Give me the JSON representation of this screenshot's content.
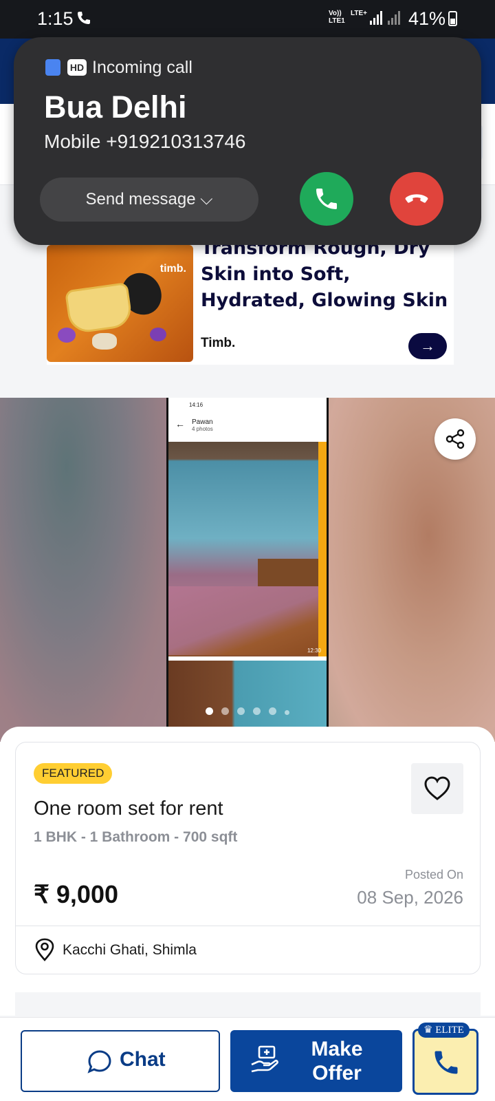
{
  "status_bar": {
    "time": "1:15",
    "network": "Vo)) LTE1",
    "lte": "LTE+",
    "battery": "41%"
  },
  "incoming_call": {
    "label": "Incoming call",
    "hd_badge": "HD",
    "caller_name": "Bua Delhi",
    "caller_number": "Mobile  +919210313746",
    "send_message_label": "Send message",
    "accept_color": "#1faa5a",
    "decline_color": "#e0443c"
  },
  "ad": {
    "image_brand": "timb.",
    "title": "Transform Rough, Dry Skin into Soft, Hydrated, Glowing Skin",
    "advertiser": "Timb.",
    "cta_icon": "arrow-right-icon"
  },
  "gallery": {
    "photo_header_title": "Pawan",
    "photo_header_sub": "4 photos",
    "photo_status_time": "14:16",
    "photo_timestamp": "12:30",
    "current_index": 1,
    "total_dots": 6
  },
  "listing": {
    "badge": "FEATURED",
    "title": "One room set for rent",
    "specs": "1 BHK - 1 Bathroom - 700 sqft",
    "price": "₹ 9,000",
    "posted_label": "Posted On",
    "posted_date": "08 Sep, 2026",
    "location": "Kacchi Ghati, Shimla"
  },
  "actions": {
    "chat_label": "Chat",
    "offer_label_line1": "Make",
    "offer_label_line2": "Offer",
    "elite_label": "♛ ELITE"
  },
  "colors": {
    "brand_blue": "#0a469c",
    "featured_yellow": "#ffce32"
  }
}
